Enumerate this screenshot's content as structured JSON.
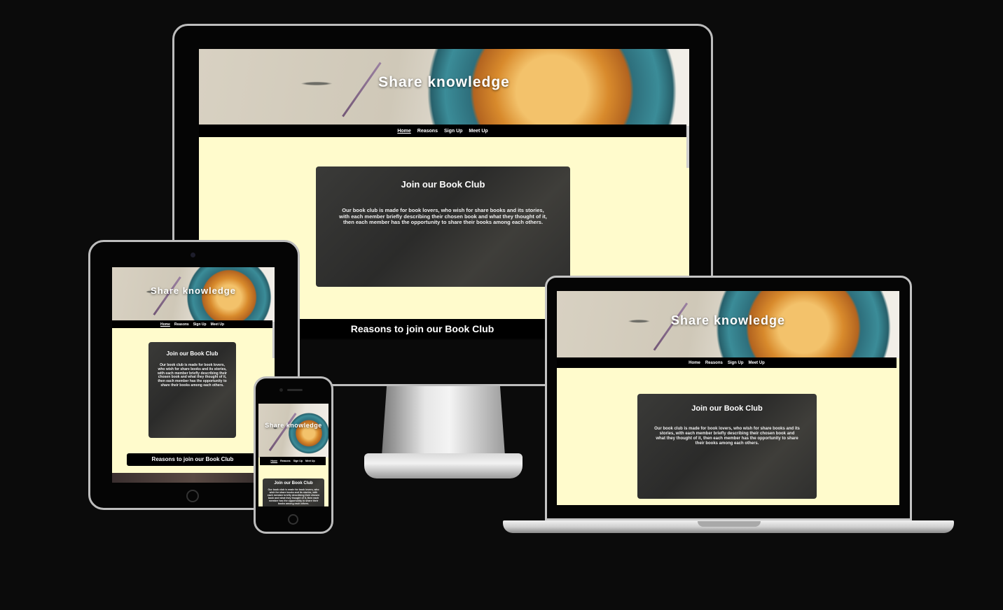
{
  "site": {
    "hero_title": "Share knowledge",
    "nav": [
      "Home",
      "Reasons",
      "Sign Up",
      "Meet Up"
    ],
    "card_title": "Join our Book Club",
    "card_text": "Our book club is made for book lovers, who wish for share books and its stories, with each member briefly describing their chosen book and what they thought of it, then each member has the opportunity to share their books among each others.",
    "reasons_title": "Reasons to join our Book Club"
  },
  "colors": {
    "page_background": "#0b0b0b",
    "site_background": "#fffbcc",
    "nav_background": "#000000",
    "card_background": "#2f2f2e"
  }
}
